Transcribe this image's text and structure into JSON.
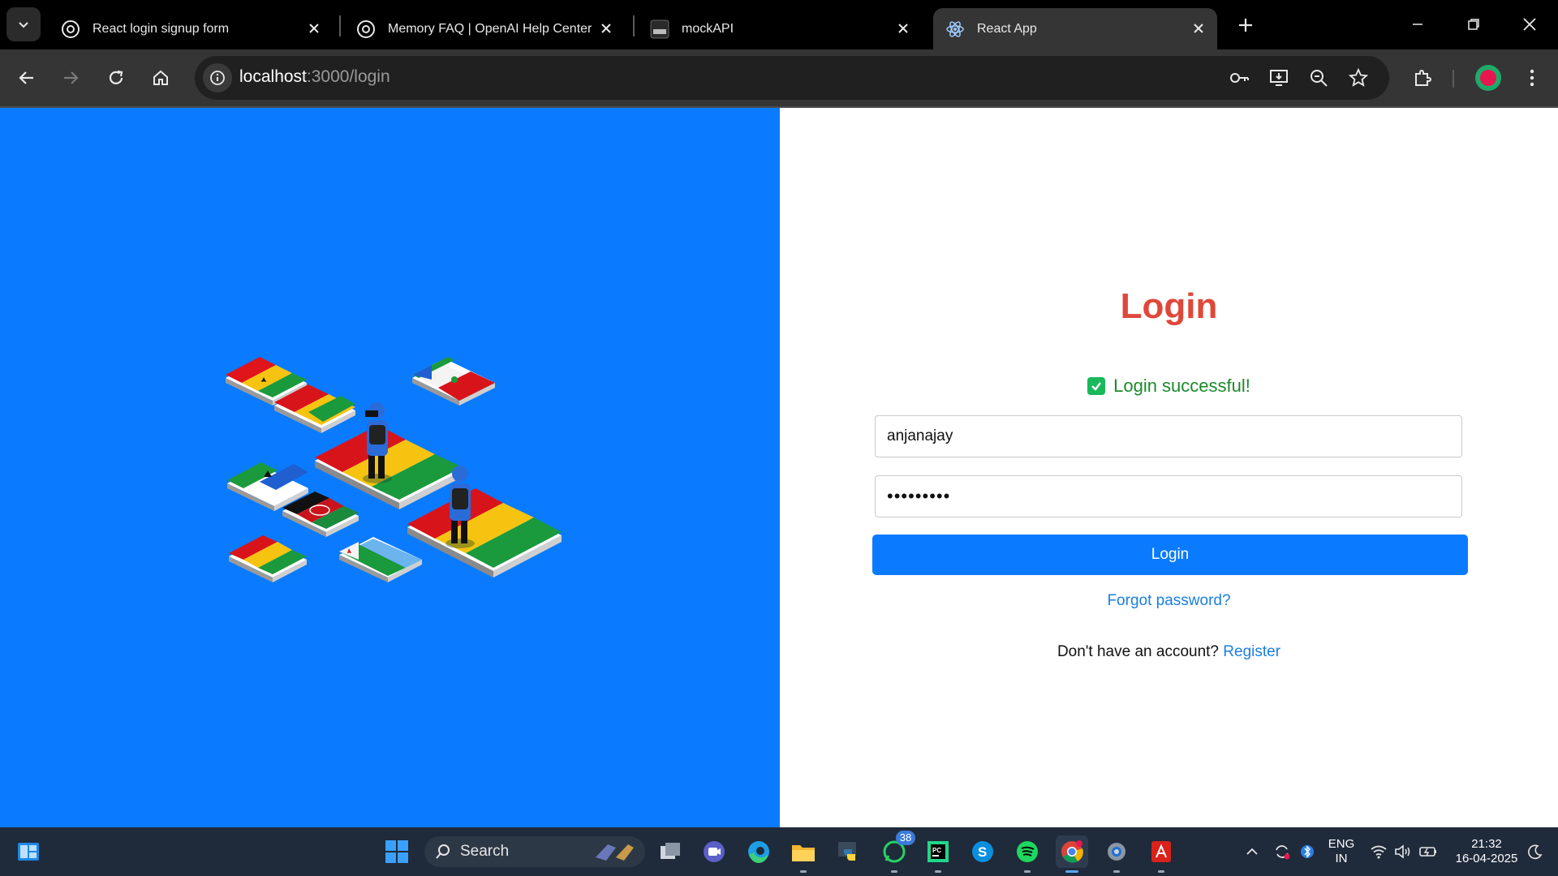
{
  "browser": {
    "tabs": [
      {
        "title": "React login signup form",
        "icon": "openai-icon",
        "active": false
      },
      {
        "title": "Memory FAQ | OpenAI Help Center",
        "icon": "openai-icon",
        "active": false
      },
      {
        "title": "mockAPI",
        "icon": "mockapi-icon",
        "active": false
      },
      {
        "title": "React App",
        "icon": "react-icon",
        "active": true
      }
    ],
    "url_host": "localhost",
    "url_path": ":3000/login"
  },
  "page": {
    "illustration": "isometric-flags-soldiers-illustration",
    "login_title": "Login",
    "success_message": "Login successful!",
    "username_value": "anjanajay",
    "password_value": "•••••••••",
    "login_button": "Login",
    "forgot_password": "Forgot password?",
    "no_account_text": "Don't have an account?",
    "register_link": "Register"
  },
  "taskbar": {
    "search_label": "Search",
    "whatsapp_badge": "38",
    "language_line1": "ENG",
    "language_line2": "IN",
    "time": "21:32",
    "date": "16-04-2025"
  },
  "colors": {
    "left_pane": "#0a7bff",
    "login_title": "#e0473a",
    "success_text": "#1b8a2b",
    "button": "#0a7bff",
    "link": "#1a7fe0"
  }
}
